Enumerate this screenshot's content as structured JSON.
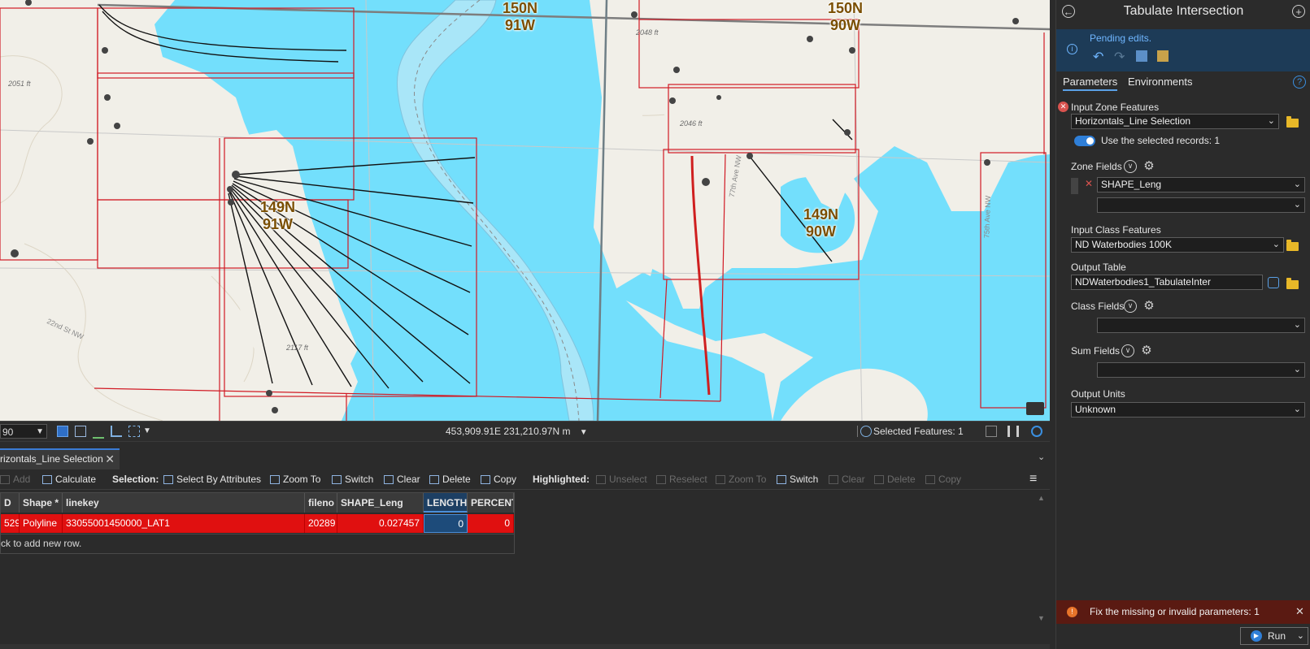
{
  "map": {
    "twp_labels": [
      {
        "line1": "150N",
        "line2": "91W"
      },
      {
        "line1": "150N",
        "line2": "90W"
      },
      {
        "line1": "149N",
        "line2": "91W"
      },
      {
        "line1": "149N",
        "line2": "90W"
      }
    ],
    "elevations": [
      "2051 ft",
      "2048 ft",
      "2046 ft",
      "2117 ft"
    ],
    "roads": [
      "22nd St NW",
      "77th Ave NW",
      "75th Ave NW"
    ],
    "colors": {
      "water": "#73dffc",
      "land": "#f1efe8",
      "section_line": "#d11a24",
      "selected_line": "#cf1f1f"
    }
  },
  "statusbar": {
    "scale": "90",
    "coordinates": "453,909.91E 231,210.97N m",
    "selected_features": "Selected Features: 1"
  },
  "attribute_table": {
    "tab_label": "rizontals_Line Selection",
    "toolbar": {
      "add": "Add",
      "calculate": "Calculate",
      "selection_label": "Selection:",
      "select_by_attributes": "Select By Attributes",
      "zoom_to": "Zoom To",
      "switch": "Switch",
      "clear": "Clear",
      "delete": "Delete",
      "copy": "Copy",
      "highlighted_label": "Highlighted:",
      "unselect": "Unselect",
      "reselect": "Reselect",
      "h_zoom_to": "Zoom To",
      "h_switch": "Switch",
      "h_clear": "Clear",
      "h_delete": "Delete",
      "h_copy": "Copy"
    },
    "columns": [
      "D",
      "Shape *",
      "linekey",
      "fileno",
      "SHAPE_Leng",
      "LENGTH",
      "PERCENT"
    ],
    "row": {
      "id": "529",
      "shape": "Polyline",
      "linekey": "33055001450000_LAT1",
      "fileno": "20289",
      "shape_leng": "0.027457",
      "length": "0",
      "percent": "0"
    },
    "new_row_hint": "ck to add new row."
  },
  "tool_panel": {
    "title": "Tabulate Intersection",
    "pending": "Pending edits.",
    "tabs": [
      "Parameters",
      "Environments"
    ],
    "input_zone_features": {
      "label": "Input Zone Features",
      "value": "Horizontals_Line Selection"
    },
    "use_selected": "Use the selected records: 1",
    "zone_fields": {
      "label": "Zone Fields",
      "value": "SHAPE_Leng",
      "value2": ""
    },
    "input_class_features": {
      "label": "Input Class Features",
      "value": "ND Waterbodies 100K"
    },
    "output_table": {
      "label": "Output Table",
      "value": "NDWaterbodies1_TabulateInter"
    },
    "class_fields": {
      "label": "Class Fields",
      "value": ""
    },
    "sum_fields": {
      "label": "Sum Fields",
      "value": ""
    },
    "output_units": {
      "label": "Output Units",
      "value": "Unknown"
    },
    "error_message": "Fix the missing or invalid parameters: 1",
    "run": "Run"
  }
}
